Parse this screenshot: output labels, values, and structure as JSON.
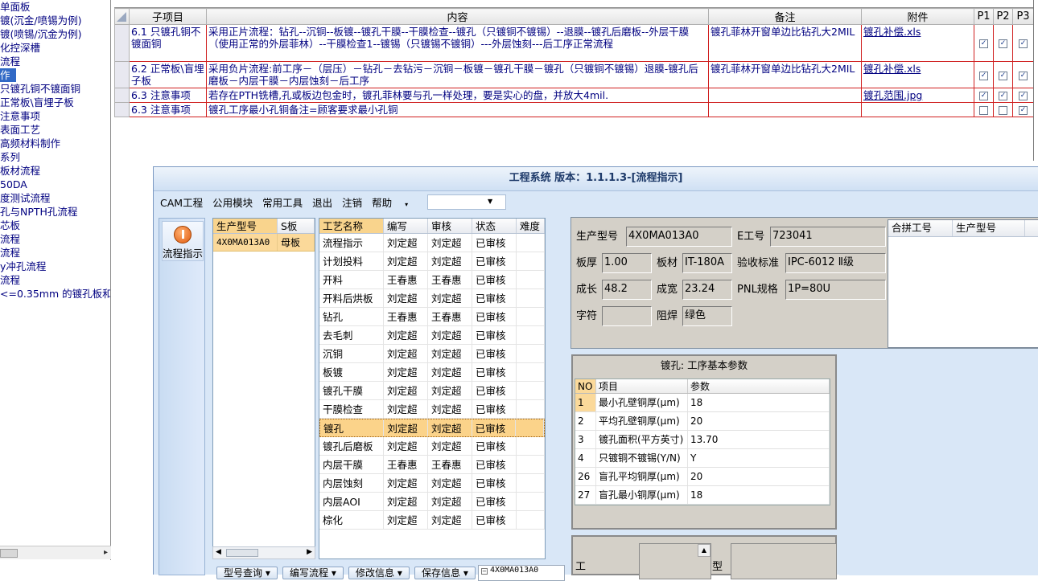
{
  "tree": {
    "items": [
      {
        "label": "单面板",
        "selected": false
      },
      {
        "label": "镀(沉金/喷锡为例)",
        "selected": false
      },
      {
        "label": "镀(喷锡/沉金为例)",
        "selected": false
      },
      {
        "label": "化控深槽",
        "selected": false
      },
      {
        "label": "流程",
        "selected": false
      },
      {
        "label": "作",
        "selected": true
      },
      {
        "label": "只镀孔铜不镀面铜",
        "selected": false
      },
      {
        "label": "正常板\\盲埋子板",
        "selected": false
      },
      {
        "label": "注意事项",
        "selected": false
      },
      {
        "label": "表面工艺",
        "selected": false
      },
      {
        "label": "高频材料制作",
        "selected": false
      },
      {
        "label": "系列",
        "selected": false
      },
      {
        "label": "板材流程",
        "selected": false
      },
      {
        "label": "50DA",
        "selected": false
      },
      {
        "label": "度测试流程",
        "selected": false
      },
      {
        "label": "孔与NPTH孔流程",
        "selected": false
      },
      {
        "label": "芯板",
        "selected": false
      },
      {
        "label": "流程",
        "selected": false
      },
      {
        "label": "流程",
        "selected": false
      },
      {
        "label": "y冲孔流程",
        "selected": false
      },
      {
        "label": "流程",
        "selected": false
      },
      {
        "label": "<=0.35mm 的镀孔板和",
        "selected": false
      }
    ]
  },
  "grid": {
    "headers": {
      "sub": "子项目",
      "content": "内容",
      "remark": "备注",
      "attach": "附件",
      "p1": "P1",
      "p2": "P2",
      "p3": "P3"
    },
    "rows": [
      {
        "sub": "6.1 只镀孔铜不镀面铜",
        "content": "采用正片流程：钻孔--沉铜--板镀--镀孔干膜--干膜检查--镀孔（只镀铜不镀锡）--退膜--镀孔后磨板--外层干膜（使用正常的外层菲林）--干膜检查1--镀锡（只镀锡不镀铜）---外层蚀刻---后工序正常流程",
        "remark": "镀孔菲林开窗单边比钻孔大2MIL",
        "attach": "镀孔补偿.xls",
        "p1": true,
        "p2": true,
        "p3": true
      },
      {
        "sub": "6.2 正常板\\盲埋子板",
        "content": "采用负片流程:前工序－（层压）－钻孔－去钻污－沉铜－板镀－镀孔干膜－镀孔（只镀铜不镀锡）退膜-镀孔后磨板－内层干膜－内层蚀刻－后工序",
        "remark": "镀孔菲林开窗单边比钻孔大2MIL",
        "attach": "镀孔补偿.xls",
        "p1": true,
        "p2": true,
        "p3": true
      },
      {
        "sub": "6.3 注意事项",
        "content": "若存在PTH铣槽,孔或板边包金时，镀孔菲林要与孔一样处理，要是实心的盘，并放大4mil.",
        "remark": "",
        "attach": "镀孔范围.jpg",
        "p1": true,
        "p2": true,
        "p3": true
      },
      {
        "sub": "6.3 注意事项",
        "content": "镀孔工序最小孔铜备注=顾客要求最小孔铜",
        "remark": "",
        "attach": "",
        "p1": false,
        "p2": false,
        "p3": true
      }
    ]
  },
  "dialog": {
    "title": "工程系统 版本：1.1.1.3-[流程指示]",
    "menu": [
      "CAM工程",
      "公用模块",
      "常用工具",
      "退出",
      "注销",
      "帮助"
    ],
    "nav_button": "流程指示",
    "model_list": {
      "headers": [
        "生产型号",
        "S板"
      ],
      "rows": [
        {
          "model": "4X0MA013A0",
          "board": "母板"
        }
      ]
    },
    "process_list": {
      "headers": [
        "工艺名称",
        "编写",
        "审核",
        "状态",
        "难度"
      ],
      "rows": [
        {
          "name": "流程指示",
          "author": "刘定超",
          "reviewer": "刘定超",
          "status": "已审核",
          "selected": false
        },
        {
          "name": "计划投料",
          "author": "刘定超",
          "reviewer": "刘定超",
          "status": "已审核",
          "selected": false
        },
        {
          "name": "开料",
          "author": "王春惠",
          "reviewer": "王春惠",
          "status": "已审核",
          "selected": false
        },
        {
          "name": "开料后烘板",
          "author": "刘定超",
          "reviewer": "刘定超",
          "status": "已审核",
          "selected": false
        },
        {
          "name": "钻孔",
          "author": "王春惠",
          "reviewer": "王春惠",
          "status": "已审核",
          "selected": false
        },
        {
          "name": "去毛刺",
          "author": "刘定超",
          "reviewer": "刘定超",
          "status": "已审核",
          "selected": false
        },
        {
          "name": "沉铜",
          "author": "刘定超",
          "reviewer": "刘定超",
          "status": "已审核",
          "selected": false
        },
        {
          "name": "板镀",
          "author": "刘定超",
          "reviewer": "刘定超",
          "status": "已审核",
          "selected": false
        },
        {
          "name": "镀孔干膜",
          "author": "刘定超",
          "reviewer": "刘定超",
          "status": "已审核",
          "selected": false
        },
        {
          "name": "干膜检查",
          "author": "刘定超",
          "reviewer": "刘定超",
          "status": "已审核",
          "selected": false
        },
        {
          "name": "镀孔",
          "author": "刘定超",
          "reviewer": "刘定超",
          "status": "已审核",
          "selected": true
        },
        {
          "name": "镀孔后磨板",
          "author": "刘定超",
          "reviewer": "刘定超",
          "status": "已审核",
          "selected": false
        },
        {
          "name": "内层干膜",
          "author": "王春惠",
          "reviewer": "王春惠",
          "status": "已审核",
          "selected": false
        },
        {
          "name": "内层蚀刻",
          "author": "刘定超",
          "reviewer": "刘定超",
          "status": "已审核",
          "selected": false
        },
        {
          "name": "内层AOI",
          "author": "刘定超",
          "reviewer": "刘定超",
          "status": "已审核",
          "selected": false
        },
        {
          "name": "棕化",
          "author": "刘定超",
          "reviewer": "刘定超",
          "status": "已审核",
          "selected": false
        }
      ]
    },
    "info": {
      "model_label": "生产型号",
      "model_value": "4X0MA013A0",
      "eno_label": "E工号",
      "eno_value": "723041",
      "thickness_label": "板厚",
      "thickness_value": "1.00",
      "material_label": "板材",
      "material_value": "IT-180A",
      "standard_label": "验收标准",
      "standard_value": "IPC-6012 Ⅱ级",
      "length_label": "成长",
      "length_value": "48.2",
      "width_label": "成宽",
      "width_value": "23.24",
      "pnl_label": "PNL规格",
      "pnl_value": "1P=80U",
      "char_label": "字符",
      "char_value": "",
      "mask_label": "阻焊",
      "mask_value": "绿色",
      "combo_headers": [
        "合拼工号",
        "生产型号"
      ]
    },
    "params": {
      "title": "镀孔: 工序基本参数",
      "headers": [
        "NO",
        "项目",
        "参数"
      ],
      "rows": [
        {
          "no": "1",
          "item": "最小孔壁铜厚(μm)",
          "value": "18"
        },
        {
          "no": "2",
          "item": "平均孔壁铜厚(μm)",
          "value": "20"
        },
        {
          "no": "3",
          "item": "镀孔面积(平方英寸)",
          "value": "13.70"
        },
        {
          "no": "4",
          "item": "只镀铜不镀锡(Y/N)",
          "value": "Y"
        },
        {
          "no": "26",
          "item": "盲孔平均铜厚(μm)",
          "value": "20"
        },
        {
          "no": "27",
          "item": "盲孔最小铜厚(μm)",
          "value": "18"
        }
      ]
    },
    "bottom": {
      "label1": "工",
      "label2": "型"
    },
    "buttons": [
      "型号查询",
      "编写流程",
      "修改信息",
      "保存信息"
    ],
    "bottom_tree_node": "4X0MA013A0"
  }
}
